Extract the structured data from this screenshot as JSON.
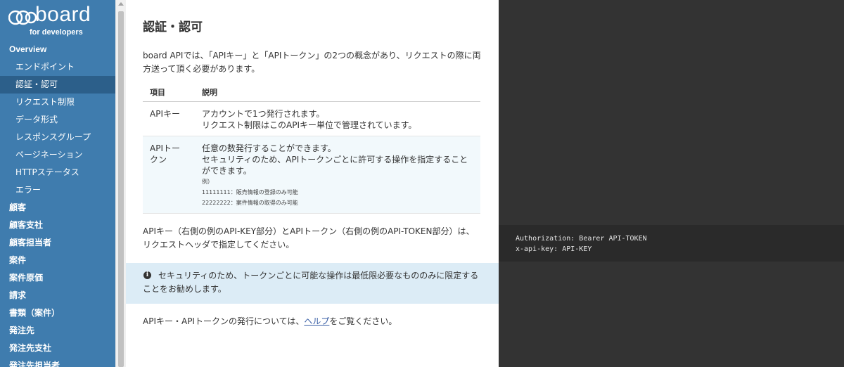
{
  "logo": {
    "word": "board",
    "tagline": "for developers"
  },
  "sidebar": {
    "items": [
      {
        "label": "Overview",
        "level": "top"
      },
      {
        "label": "エンドポイント",
        "level": "sub"
      },
      {
        "label": "認証・認可",
        "level": "sub",
        "active": true
      },
      {
        "label": "リクエスト制限",
        "level": "sub"
      },
      {
        "label": "データ形式",
        "level": "sub"
      },
      {
        "label": "レスポンスグループ",
        "level": "sub"
      },
      {
        "label": "ページネーション",
        "level": "sub"
      },
      {
        "label": "HTTPステータス",
        "level": "sub"
      },
      {
        "label": "エラー",
        "level": "sub"
      },
      {
        "label": "顧客",
        "level": "top"
      },
      {
        "label": "顧客支社",
        "level": "top"
      },
      {
        "label": "顧客担当者",
        "level": "top"
      },
      {
        "label": "案件",
        "level": "top"
      },
      {
        "label": "案件原価",
        "level": "top"
      },
      {
        "label": "請求",
        "level": "top"
      },
      {
        "label": "書類（案件）",
        "level": "top"
      },
      {
        "label": "発注先",
        "level": "top"
      },
      {
        "label": "発注先支社",
        "level": "top"
      },
      {
        "label": "発注先担当者",
        "level": "top"
      }
    ]
  },
  "main": {
    "title": "認証・認可",
    "intro": "board APIでは、「APIキー」と「APIトークン」の2つの概念があり、リクエストの際に両方送って頂く必要があります。",
    "table": {
      "headers": [
        "項目",
        "説明"
      ],
      "rows": [
        {
          "item": "APIキー",
          "desc": [
            "アカウントで1つ発行されます。",
            "リクエスト制限はこのAPIキー単位で管理されています。"
          ]
        },
        {
          "item": "APIトークン",
          "desc": [
            "任意の数発行することができます。",
            "セキュリティのため、APIトークンごとに許可する操作を指定することができます。"
          ],
          "example_label": "例）",
          "examples": [
            "11111111：販売情報の登録のみ可能",
            "22222222：案件情報の取得のみ可能"
          ]
        }
      ]
    },
    "note": "APIキー（右側の例のAPI-KEY部分）とAPIトークン（右側の例のAPI-TOKEN部分）は、リクエストヘッダで指定してください。",
    "callout": "セキュリティのため、トークンごとに可能な操作は最低限必要なもののみに限定することをお勧めします。",
    "issuance": {
      "before": "APIキー・APIトークンの発行については、",
      "link": "ヘルプ",
      "after": "をご覧ください。"
    }
  },
  "code": {
    "lines": [
      "Authorization: Bearer API-TOKEN",
      "x-api-key: API-KEY"
    ]
  },
  "colors": {
    "sidebar": "#3f7cae",
    "sidebar_active": "#2c5f8a",
    "callout": "#dcecf6",
    "code_pane": "#333333"
  }
}
